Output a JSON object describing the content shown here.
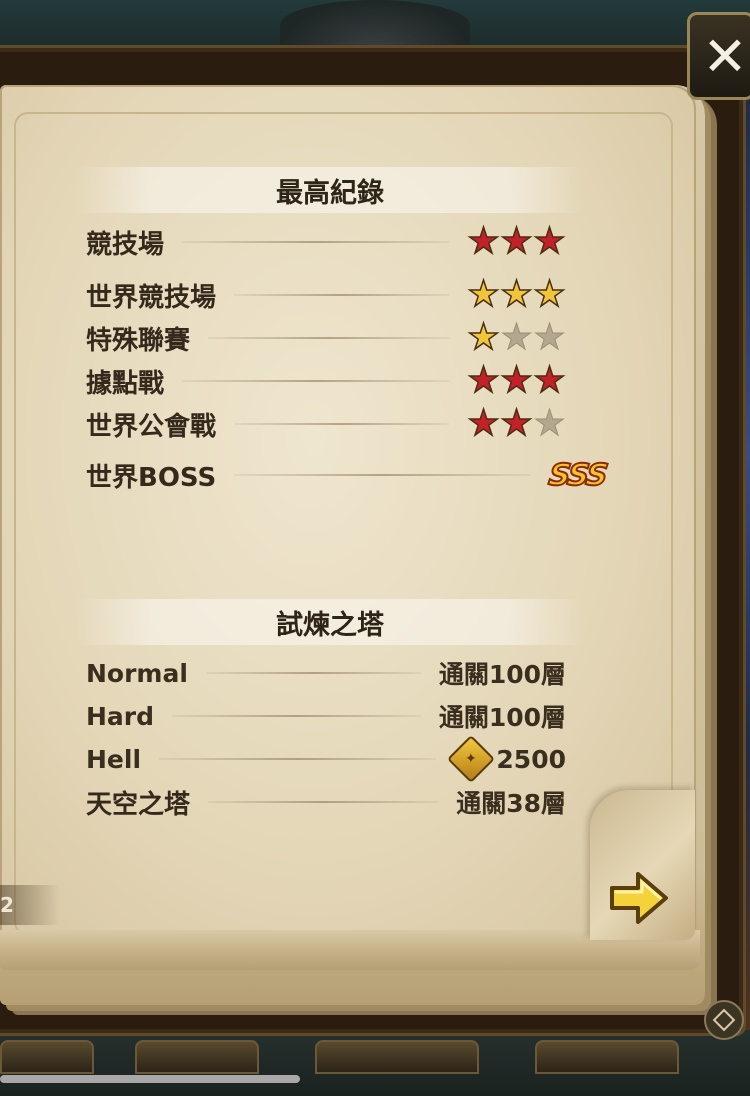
{
  "records": {
    "title": "最高紀錄",
    "rows": [
      {
        "label": "競技場",
        "stars": 3,
        "filled": 3,
        "color": "red"
      },
      {
        "label": "世界競技場",
        "stars": 3,
        "filled": 3,
        "color": "gold"
      },
      {
        "label": "特殊聯賽",
        "stars": 3,
        "filled": 1,
        "color": "gold"
      },
      {
        "label": "據點戰",
        "stars": 3,
        "filled": 3,
        "color": "red"
      },
      {
        "label": "世界公會戰",
        "stars": 3,
        "filled": 2,
        "color": "red"
      }
    ],
    "world_boss": {
      "label": "世界BOSS",
      "rank": "SSS"
    }
  },
  "tower": {
    "title": "試煉之塔",
    "rows": [
      {
        "label": "Normal",
        "value": "通關100層"
      },
      {
        "label": "Hard",
        "value": "通關100層"
      },
      {
        "label": "Hell",
        "value": "2500",
        "icon": "tower-medal-icon"
      },
      {
        "label": "天空之塔",
        "value": "通關38層"
      }
    ]
  },
  "page_indicator": "2",
  "close_label": "✕"
}
